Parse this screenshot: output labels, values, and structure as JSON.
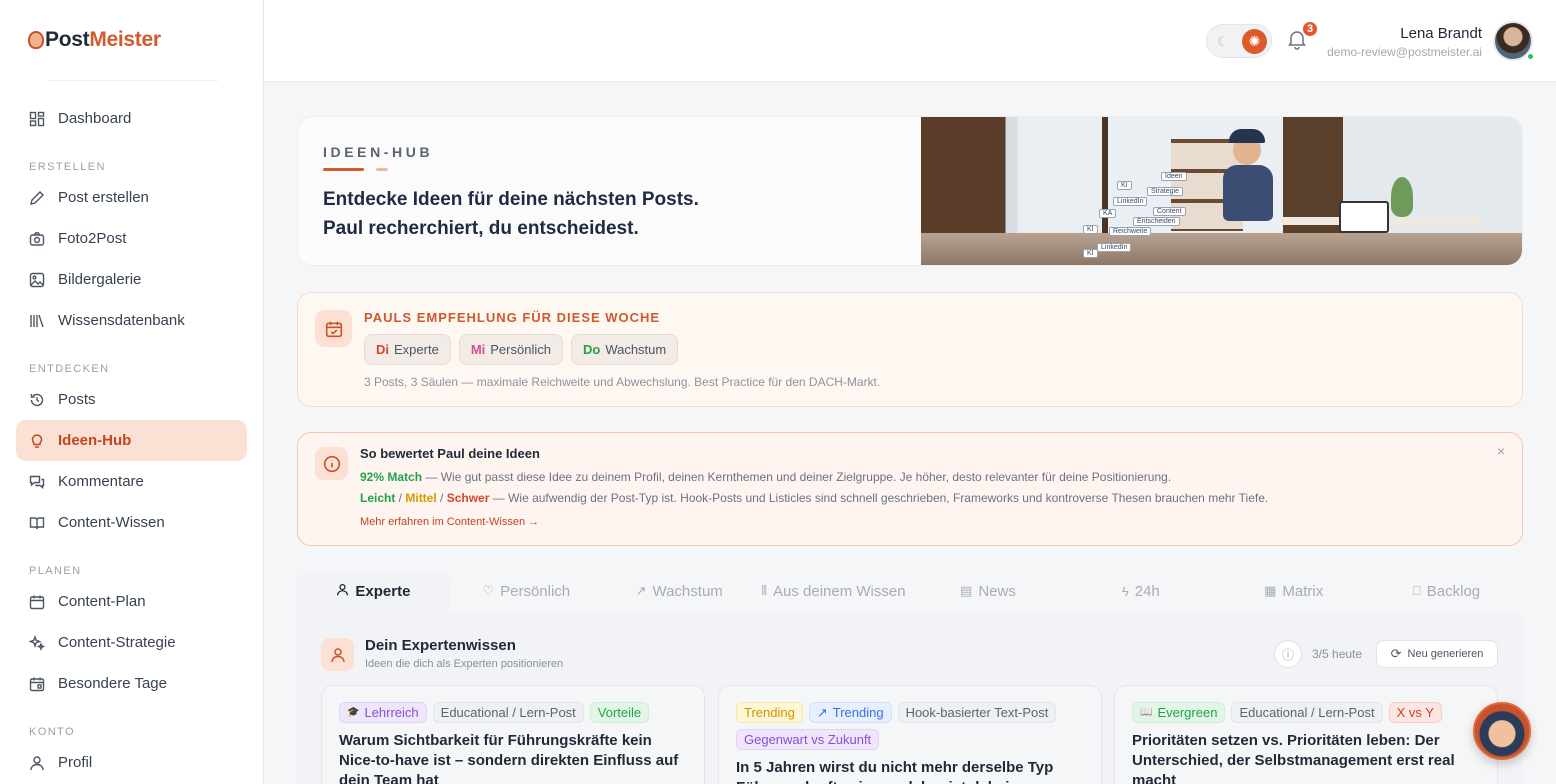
{
  "brand": {
    "part1": "Post",
    "part2": "Meister"
  },
  "sidebar": {
    "dashboard": "Dashboard",
    "sections": {
      "erstellen": "ERSTELLEN",
      "entdecken": "ENTDECKEN",
      "planen": "PLANEN",
      "konto": "KONTO"
    },
    "items": {
      "post_erstellen": "Post erstellen",
      "foto2post": "Foto2Post",
      "bildergalerie": "Bildergalerie",
      "wissensdatenbank": "Wissensdatenbank",
      "posts": "Posts",
      "ideen_hub": "Ideen-Hub",
      "kommentare": "Kommentare",
      "content_wissen": "Content-Wissen",
      "content_plan": "Content-Plan",
      "content_strategie": "Content-Strategie",
      "besondere_tage": "Besondere Tage",
      "profil": "Profil"
    }
  },
  "header": {
    "notifications_count": "3",
    "user_name": "Lena Brandt",
    "user_email": "demo-review@postmeister.ai"
  },
  "hero": {
    "label": "IDEEN-HUB",
    "line1": "Entdecke Ideen für deine nächsten Posts.",
    "line2": "Paul recherchiert, du entscheidest.",
    "image_tags": [
      "Ideen",
      "KI",
      "Strategie",
      "LinkedIn",
      "Content",
      "KA",
      "Entscheiden",
      "KI",
      "Reichweite",
      "LinkedIn",
      "KI"
    ]
  },
  "recommendation": {
    "title": "PAULS EMPFEHLUNG FÜR DIESE WOCHE",
    "chips": [
      {
        "day": "Di",
        "label": "Experte",
        "color": "#d6482a"
      },
      {
        "day": "Mi",
        "label": "Persönlich",
        "color": "#d64f8f"
      },
      {
        "day": "Do",
        "label": "Wachstum",
        "color": "#22a34a"
      }
    ],
    "note": "3 Posts, 3 Säulen — maximale Reichweite und Abwechslung. Best Practice für den DACH-Markt."
  },
  "info": {
    "title": "So bewertet Paul deine Ideen",
    "match_label": "92% Match",
    "match_text": " — Wie gut passt diese Idee zu deinem Profil, deinen Kernthemen und deiner Zielgruppe. Je höher, desto relevanter für deine Positionierung.",
    "easy": "Leicht",
    "medium": "Mittel",
    "hard": "Schwer",
    "sep": " / ",
    "effort_text": " — Wie aufwendig der Post-Typ ist. Hook-Posts und Listicles sind schnell geschrieben, Frameworks und kontroverse Thesen brauchen mehr Tiefe.",
    "link": "Mehr erfahren im Content-Wissen →",
    "close": "×"
  },
  "tabs": [
    {
      "label": "Experte",
      "icon": "user-icon"
    },
    {
      "label": "Persönlich",
      "icon": "heart-icon"
    },
    {
      "label": "Wachstum",
      "icon": "trending-icon"
    },
    {
      "label": "Aus deinem Wissen",
      "icon": "library-icon"
    },
    {
      "label": "News",
      "icon": "newspaper-icon"
    },
    {
      "label": "24h",
      "icon": "bolt-icon"
    },
    {
      "label": "Matrix",
      "icon": "grid-icon"
    },
    {
      "label": "Backlog",
      "icon": "book-icon"
    }
  ],
  "panel": {
    "title": "Dein Expertenwissen",
    "subtitle": "Ideen die dich als Experten positionieren",
    "count": "3/5 heute",
    "regenerate": "Neu generieren"
  },
  "cards": [
    {
      "badges": [
        {
          "text": "Lehrreich",
          "style": "purple",
          "icon": "🎓"
        },
        {
          "text": "Educational / Lern-Post",
          "style": "grey"
        },
        {
          "text": "Vorteile",
          "style": "green"
        }
      ],
      "title": "Warum Sichtbarkeit für Führungskräfte kein Nice-to-have ist – sondern direkten Einfluss auf dein Team hat"
    },
    {
      "badges": [
        {
          "text": "Trending",
          "style": "yellow"
        },
        {
          "text": "Trending",
          "style": "blue",
          "icon": "↗"
        },
        {
          "text": "Hook-basierter Text-Post",
          "style": "grey"
        },
        {
          "text": "Gegenwart vs Zukunft",
          "style": "purple"
        }
      ],
      "title": "In 5 Jahren wirst du nicht mehr derselbe Typ Führungskraft sein – welcher ist dabei zu entstehen?"
    },
    {
      "badges": [
        {
          "text": "Evergreen",
          "style": "green",
          "icon": "📖"
        },
        {
          "text": "Educational / Lern-Post",
          "style": "grey"
        },
        {
          "text": "X vs Y",
          "style": "red"
        }
      ],
      "title": "Prioritäten setzen vs. Prioritäten leben: Der Unterschied, der Selbstmanagement erst real macht"
    }
  ]
}
